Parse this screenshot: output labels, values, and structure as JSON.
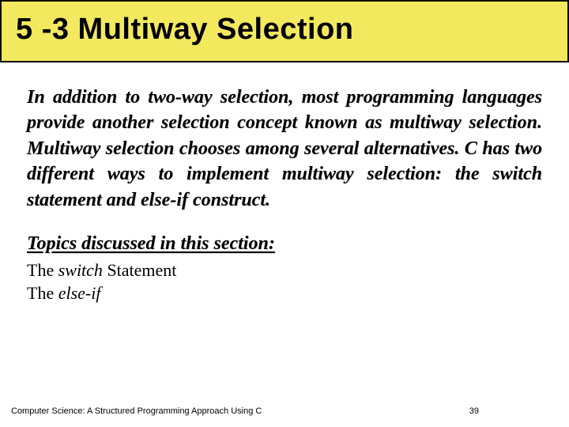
{
  "title": "5 -3   Multiway Selection",
  "intro": "In addition to two-way selection, most programming languages provide another selection concept known as multiway selection. Multiway selection chooses among several alternatives. C has two different ways to implement multiway selection: the switch statement and else-if construct.",
  "topics_heading": "Topics discussed in this section:",
  "topics": {
    "line1_prefix": "The ",
    "line1_italic": "switch",
    "line1_suffix": " Statement",
    "line2_prefix": "The ",
    "line2_italic": "else-if",
    "line2_suffix": ""
  },
  "footer_left": "Computer Science: A Structured Programming Approach Using C",
  "footer_page": "39"
}
